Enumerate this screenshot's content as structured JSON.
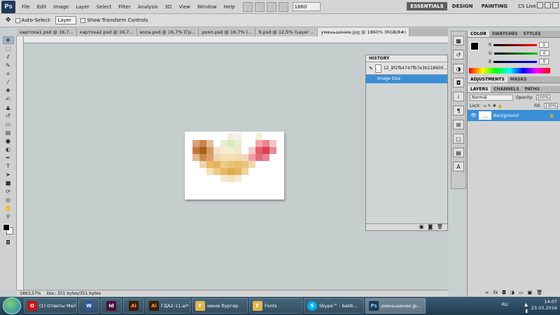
{
  "app_logo": "Ps",
  "menu": [
    "File",
    "Edit",
    "Image",
    "Layer",
    "Select",
    "Filter",
    "Analysis",
    "3D",
    "View",
    "Window",
    "Help"
  ],
  "zoom": "1860",
  "workspaces": [
    "ESSENTIALS",
    "DESIGN",
    "PAINTING"
  ],
  "cslive": "CS Live",
  "options": {
    "auto_select": "Auto-Select:",
    "layer": "Layer",
    "transform": "Show Transform Controls"
  },
  "tabs": [
    {
      "label": "картоха1.psd @ 16,7..."
    },
    {
      "label": "картоха2.psd @ 16,7..."
    },
    {
      "label": "вола.psd @ 16,7% (Гр..."
    },
    {
      "label": "роял.psd @ 16,7% (..."
    },
    {
      "label": "9.psd @ 12,5% (Layer ..."
    },
    {
      "label": "уменьшение.jpg @ 1860% (RGB/8#)"
    }
  ],
  "status": {
    "zoom": "1863,57%",
    "doc": "Doc: 351 bytes/351 bytes"
  },
  "history": {
    "title": "HISTORY",
    "snapshot": "12_8f2fb4747fb7e36218600...",
    "step": "Image Size"
  },
  "color_panel": {
    "tabs": [
      "COLOR",
      "SWATCHES",
      "STYLES"
    ],
    "r": "0",
    "g": "0",
    "b": "0"
  },
  "adjust_tabs": [
    "ADJUSTMENTS",
    "MASKS"
  ],
  "layers_panel": {
    "tabs": [
      "LAYERS",
      "CHANNELS",
      "PATHS"
    ],
    "blend": "Normal",
    "opacity_label": "Opacity:",
    "opacity": "100%",
    "lock_label": "Lock:",
    "fill_label": "Fill:",
    "fill": "100%",
    "layer_name": "Background"
  },
  "taskbar": {
    "items": [
      {
        "label": "(1) Ответы Mail...",
        "icon": "O"
      },
      {
        "label": "",
        "icon": "W"
      },
      {
        "label": "",
        "icon": "Id"
      },
      {
        "label": "",
        "icon": "Ai"
      },
      {
        "label": "ГДА2-11.ai* @ ...",
        "icon": "Ai"
      },
      {
        "label": "меню бургер",
        "icon": "F"
      },
      {
        "label": "Fonts",
        "icon": "F"
      },
      {
        "label": "Skype™ - baldi...",
        "icon": "S"
      },
      {
        "label": "уменьшение.jp...",
        "icon": "Ps"
      }
    ],
    "lang": "RU",
    "time": "14:07",
    "date": "23.03.2016"
  }
}
